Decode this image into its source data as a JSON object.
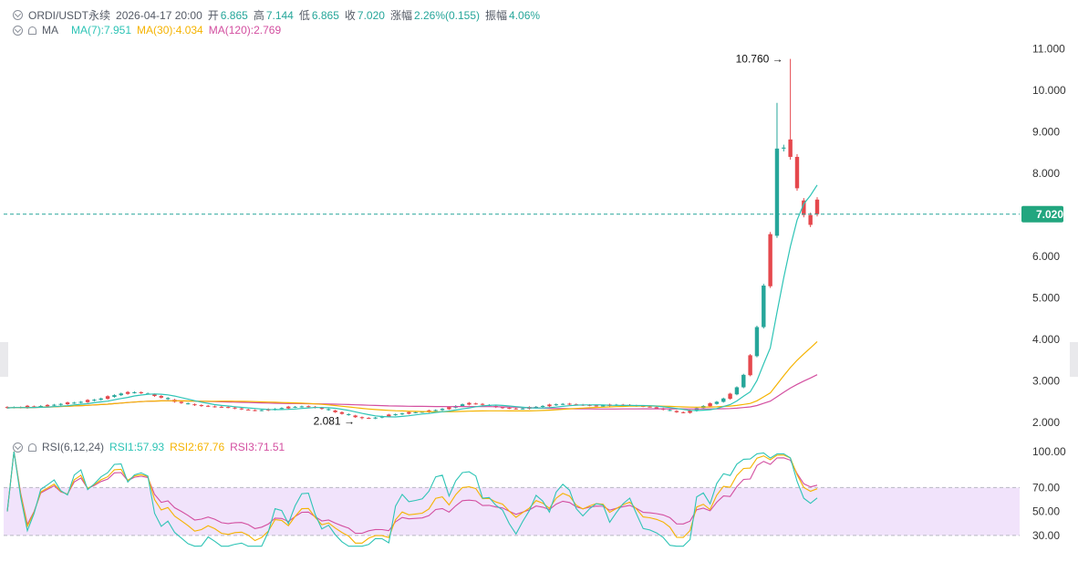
{
  "header": {
    "symbol": "ORDI/USDT永续",
    "datetime": "2026-04-17 20:00",
    "open_label": "开",
    "open": "6.865",
    "high_label": "高",
    "high": "7.144",
    "low_label": "低",
    "low": "6.865",
    "close_label": "收",
    "close": "7.020",
    "change_label": "涨幅",
    "change": "2.26%(0.155)",
    "amplitude_label": "振幅",
    "amplitude": "4.06%"
  },
  "ma_legend": {
    "label": "MA",
    "ma7": "MA(7):7.951",
    "ma30": "MA(30):4.034",
    "ma120": "MA(120):2.769"
  },
  "rsi_legend": {
    "label": "RSI(6,12,24)",
    "rsi1": "RSI1:57.93",
    "rsi2": "RSI2:67.76",
    "rsi3": "RSI3:71.51"
  },
  "colors": {
    "up": "#26a69a",
    "down": "#e5484d",
    "ma7": "#2ec4b6",
    "ma30": "#f5b301",
    "ma120": "#d34fa0",
    "rsi1": "#2ec4b6",
    "rsi2": "#f5b301",
    "rsi3": "#d34fa0",
    "rsi_band": "#f1e3fb",
    "text": "#333333"
  },
  "chart_data": [
    {
      "type": "candlestick",
      "title": "ORDI/USDT永续",
      "y_ticks": [
        "11.000",
        "10.000",
        "9.000",
        "8.000",
        "7.000",
        "6.000",
        "5.000",
        "4.000",
        "3.000",
        "2.000"
      ],
      "ylim": [
        1.85,
        11.3
      ],
      "last_price": 7.02,
      "last_price_label": "7.020",
      "annotations": [
        {
          "label": "10.760",
          "value": 10.76,
          "kind": "max"
        },
        {
          "label": "2.081",
          "value": 2.081,
          "kind": "min"
        }
      ],
      "ohlc_estimated": {
        "base": [
          2.36,
          2.37,
          2.36,
          2.39,
          2.38,
          2.4,
          2.41,
          2.43,
          2.45,
          2.47,
          2.48,
          2.5,
          2.53,
          2.55,
          2.58,
          2.62,
          2.66,
          2.7,
          2.72,
          2.73,
          2.71,
          2.68,
          2.64,
          2.6,
          2.55,
          2.5,
          2.47,
          2.44,
          2.42,
          2.4,
          2.39,
          2.38,
          2.37,
          2.36,
          2.34,
          2.32,
          2.3,
          2.29,
          2.3,
          2.31,
          2.33,
          2.35,
          2.37,
          2.38,
          2.39,
          2.38,
          2.36,
          2.33,
          2.29,
          2.25,
          2.21,
          2.17,
          2.13,
          2.11,
          2.1,
          2.12,
          2.15,
          2.18,
          2.2,
          2.22,
          2.24,
          2.25,
          2.26,
          2.28,
          2.3,
          2.33,
          2.36,
          2.4,
          2.44,
          2.46,
          2.45,
          2.43,
          2.4,
          2.37,
          2.35,
          2.34,
          2.33,
          2.34,
          2.36,
          2.38,
          2.4,
          2.42,
          2.44,
          2.45,
          2.44,
          2.43,
          2.42,
          2.41,
          2.4,
          2.41,
          2.42,
          2.43,
          2.42,
          2.41,
          2.4,
          2.39,
          2.37,
          2.34,
          2.31,
          2.28,
          2.25,
          2.24,
          2.28,
          2.35,
          2.4,
          2.45,
          2.5,
          2.58,
          2.68,
          2.85,
          3.15,
          3.6,
          4.3,
          5.3,
          6.5,
          8.6,
          8.8,
          8.4,
          7.8,
          7.0,
          6.9,
          7.02
        ]
      }
    },
    {
      "type": "line",
      "title": "RSI(6,12,24)",
      "y_ticks": [
        "100.00",
        "70.00",
        "50.00",
        "30.00"
      ],
      "ylim": [
        20,
        100
      ],
      "band": [
        30,
        70
      ],
      "series": [
        {
          "name": "RSI1",
          "last": 57.93
        },
        {
          "name": "RSI2",
          "last": 67.76
        },
        {
          "name": "RSI3",
          "last": 71.51
        }
      ]
    }
  ]
}
